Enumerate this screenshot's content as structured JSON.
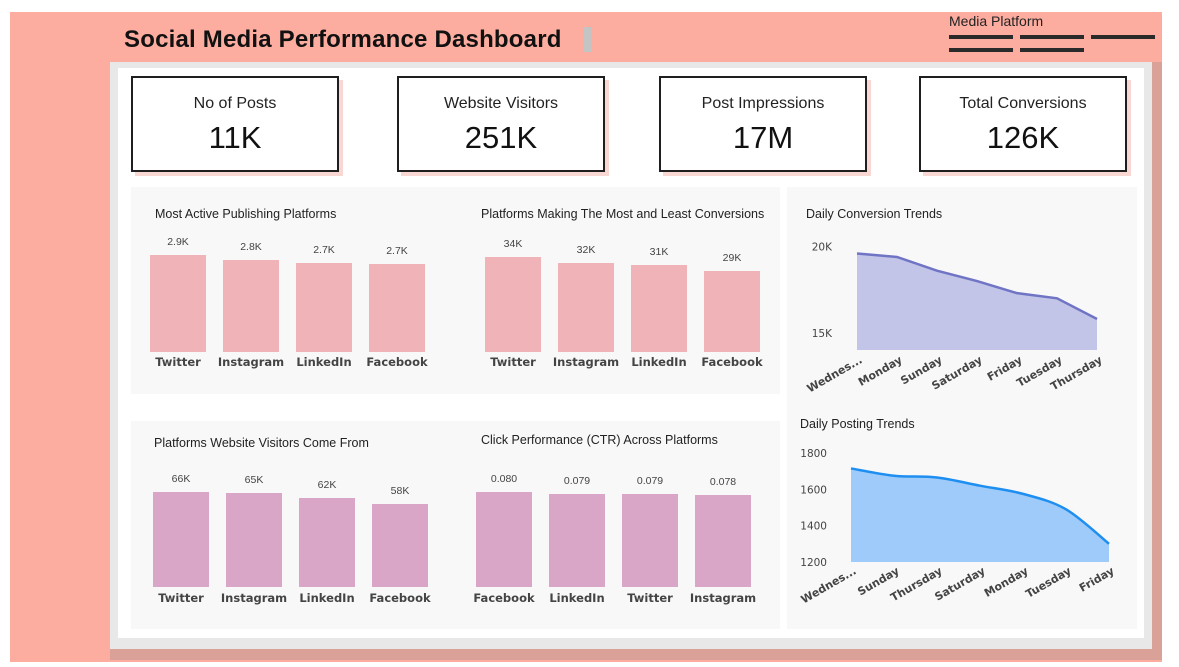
{
  "header": {
    "title": "Social Media Performance Dashboard",
    "slicer_label": "Media Platform"
  },
  "kpis": [
    {
      "label": "No of Posts",
      "value": "11K"
    },
    {
      "label": "Website Visitors",
      "value": "251K"
    },
    {
      "label": "Post Impressions",
      "value": "17M"
    },
    {
      "label": "Total Conversions",
      "value": "126K"
    }
  ],
  "colors": {
    "frame": "#fdada0",
    "bar_pink": "#f0b4b8",
    "bar_mauve": "#d9a6c8",
    "area_conversion_fill": "#c3c5e8",
    "area_conversion_line": "#6f74c4",
    "area_posting_fill": "#9ecbfa",
    "area_posting_line": "#1e8ff0"
  },
  "chart_data": [
    {
      "type": "bar",
      "title": "Most Active Publishing Platforms",
      "categories": [
        "Twitter",
        "Instagram",
        "LinkedIn",
        "Facebook"
      ],
      "values": [
        2900,
        2800,
        2700,
        2700
      ],
      "labels": [
        "2.9K",
        "2.8K",
        "2.7K",
        "2.7K"
      ]
    },
    {
      "type": "bar",
      "title": "Platforms Making The Most and Least Conversions",
      "categories": [
        "Twitter",
        "Instagram",
        "LinkedIn",
        "Facebook"
      ],
      "values": [
        34000,
        32000,
        31000,
        29000
      ],
      "labels": [
        "34K",
        "32K",
        "31K",
        "29K"
      ]
    },
    {
      "type": "bar",
      "title": "Platforms Website Visitors Come From",
      "categories": [
        "Twitter",
        "Instagram",
        "LinkedIn",
        "Facebook"
      ],
      "values": [
        66000,
        65000,
        62000,
        58000
      ],
      "labels": [
        "66K",
        "65K",
        "62K",
        "58K"
      ]
    },
    {
      "type": "bar",
      "title": "Click Performance (CTR) Across Platforms",
      "categories": [
        "Facebook",
        "LinkedIn",
        "Twitter",
        "Instagram"
      ],
      "values": [
        0.08,
        0.079,
        0.079,
        0.078
      ],
      "labels": [
        "0.080",
        "0.079",
        "0.079",
        "0.078"
      ]
    },
    {
      "type": "area",
      "title": "Daily Conversion Trends",
      "categories": [
        "Wednes...",
        "Monday",
        "Sunday",
        "Saturday",
        "Friday",
        "Tuesday",
        "Thursday"
      ],
      "values": [
        19600,
        19400,
        18600,
        18000,
        17300,
        17000,
        15800
      ],
      "ylim": [
        14000,
        20500
      ],
      "yticks": [
        15000,
        20000
      ],
      "ytick_labels": [
        "15K",
        "20K"
      ]
    },
    {
      "type": "area",
      "title": "Daily Posting Trends",
      "categories": [
        "Wednes...",
        "Sunday",
        "Thursday",
        "Saturday",
        "Monday",
        "Tuesday",
        "Friday"
      ],
      "values": [
        1715,
        1675,
        1665,
        1620,
        1575,
        1490,
        1300
      ],
      "ylim": [
        1200,
        1800
      ],
      "yticks": [
        1200,
        1400,
        1600,
        1800
      ],
      "ytick_labels": [
        "1200",
        "1400",
        "1600",
        "1800"
      ]
    }
  ]
}
